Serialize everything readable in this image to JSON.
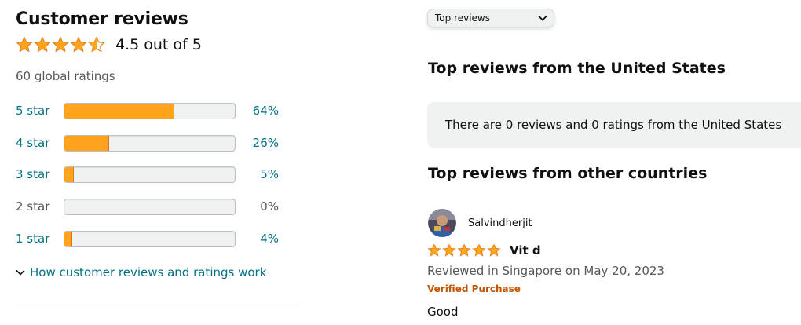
{
  "summary": {
    "title": "Customer reviews",
    "average_rating": 4.5,
    "max_rating": 5,
    "rating_text": "4.5 out of 5",
    "global_ratings": "60 global ratings",
    "star_color": "#ffa41c"
  },
  "histogram": [
    {
      "label": "5 star",
      "percent_text": "64%",
      "percent": 64
    },
    {
      "label": "4 star",
      "percent_text": "26%",
      "percent": 26
    },
    {
      "label": "3 star",
      "percent_text": "5%",
      "percent": 5
    },
    {
      "label": "2 star",
      "percent_text": "0%",
      "percent": 0
    },
    {
      "label": "1 star",
      "percent_text": "4%",
      "percent": 4
    }
  ],
  "how_link": {
    "label": "How customer reviews and ratings work",
    "icon": "chevron-down-icon"
  },
  "sort": {
    "selected": "Top reviews",
    "icon": "chevron-down-icon"
  },
  "us_section": {
    "heading": "Top reviews from the United States",
    "empty_message": "There are 0 reviews and 0 ratings from the United States"
  },
  "other_section": {
    "heading": "Top reviews from other countries",
    "reviews": [
      {
        "reviewer": "Salvindherjit",
        "rating": 5,
        "title": "Vit d",
        "meta": "Reviewed in Singapore on May 20, 2023",
        "badge": "Verified Purchase",
        "body": "Good"
      }
    ]
  }
}
